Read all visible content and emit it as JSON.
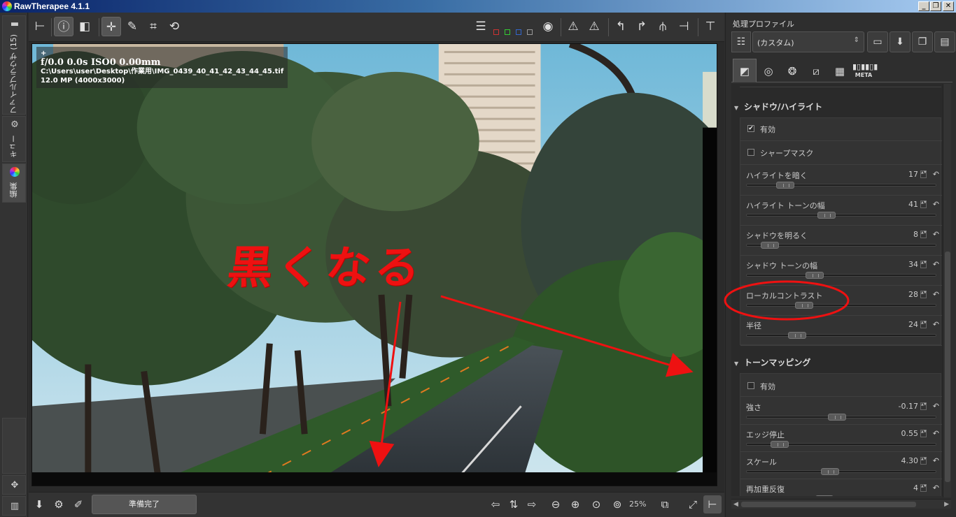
{
  "window": {
    "title": "RawTherapee 4.1.1",
    "controls": {
      "minimize": "_",
      "restore": "❐",
      "close": "✕"
    }
  },
  "left_tabs": {
    "file_browser": "ファイルブラウザ (15)",
    "queue": "キュー",
    "editor": "編集"
  },
  "image_info": {
    "line1": "f/0.0  0.0s  ISO0  0.00mm",
    "plus": "+",
    "path": "C:\\Users\\user\\Desktop\\作業用\\IMG_0439_40_41_42_43_44_45.tif",
    "resolution": "12.0 MP (4000x3000)"
  },
  "status": {
    "text": "準備完了",
    "zoom": "25%"
  },
  "annotation": {
    "text": "黒くなる",
    "color": "#ee1111"
  },
  "right_panel": {
    "title": "処理プロファイル",
    "profile_value": "(カスタム)",
    "meta_tab": "META"
  },
  "shadows_highlights": {
    "title": "シャドウ/ハイライト",
    "enabled_label": "有効",
    "enabled": true,
    "sharp_mask_label": "シャープマスク",
    "sharp_mask": false,
    "sliders": [
      {
        "label": "ハイライトを暗く",
        "value": "17",
        "pos": 0.17
      },
      {
        "label": "ハイライト トーンの幅",
        "value": "41",
        "pos": 0.41
      },
      {
        "label": "シャドウを明るく",
        "value": "8",
        "pos": 0.08
      },
      {
        "label": "シャドウ トーンの幅",
        "value": "34",
        "pos": 0.34
      },
      {
        "label": "ローカルコントラスト",
        "value": "28",
        "pos": 0.28
      },
      {
        "label": "半径",
        "value": "24",
        "pos": 0.24
      }
    ]
  },
  "tone_mapping": {
    "title": "トーンマッピング",
    "enabled_label": "有効",
    "enabled": false,
    "sliders": [
      {
        "label": "強さ",
        "value": "-0.17",
        "pos": 0.47
      },
      {
        "label": "エッジ停止",
        "value": "0.55",
        "pos": 0.14
      },
      {
        "label": "スケール",
        "value": "4.30",
        "pos": 0.43
      },
      {
        "label": "再加重反復",
        "value": "4",
        "pos": 0.4
      }
    ]
  }
}
